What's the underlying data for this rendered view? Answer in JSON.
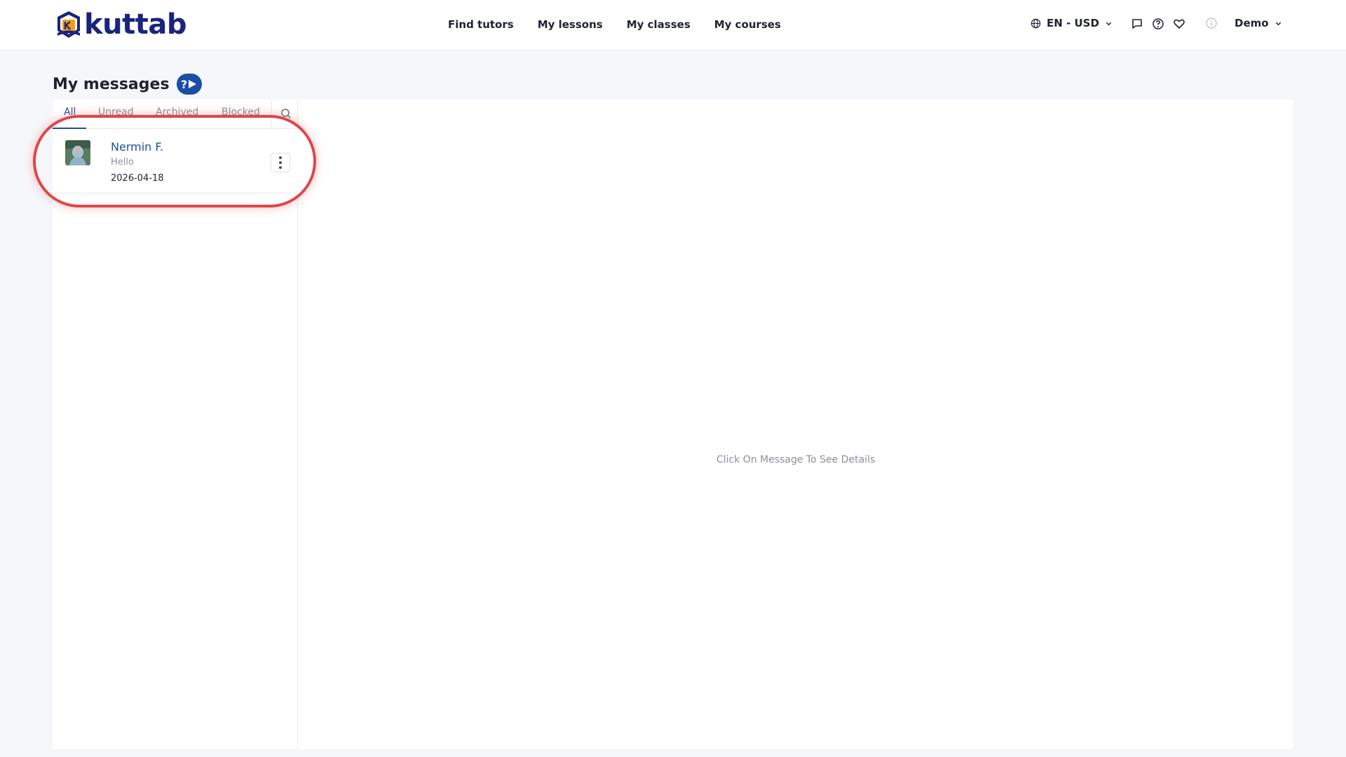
{
  "header": {
    "logo_text": "kuttab",
    "nav": [
      "Find tutors",
      "My lessons",
      "My classes",
      "My courses"
    ],
    "language_currency": "EN - USD",
    "user_name": "Demo"
  },
  "page": {
    "title": "My messages",
    "help_label": "?"
  },
  "messages": {
    "tabs": [
      "All",
      "Unread",
      "Archived",
      "Blocked"
    ],
    "active_tab": "All",
    "threads": [
      {
        "name": "Nermin F.",
        "preview": "Hello",
        "date": "2026-04-18"
      }
    ],
    "empty_detail_text": "Click On Message To See Details"
  },
  "colors": {
    "brand": "#1a237e",
    "accent": "#1b4ea8",
    "highlight": "#e0464a"
  },
  "icons": {
    "language": "globe-icon",
    "chat": "chat-icon",
    "help": "help-icon",
    "wishlist": "heart-icon",
    "info": "info-icon",
    "search": "search-icon",
    "thread_menu": "kebab-menu-icon"
  }
}
